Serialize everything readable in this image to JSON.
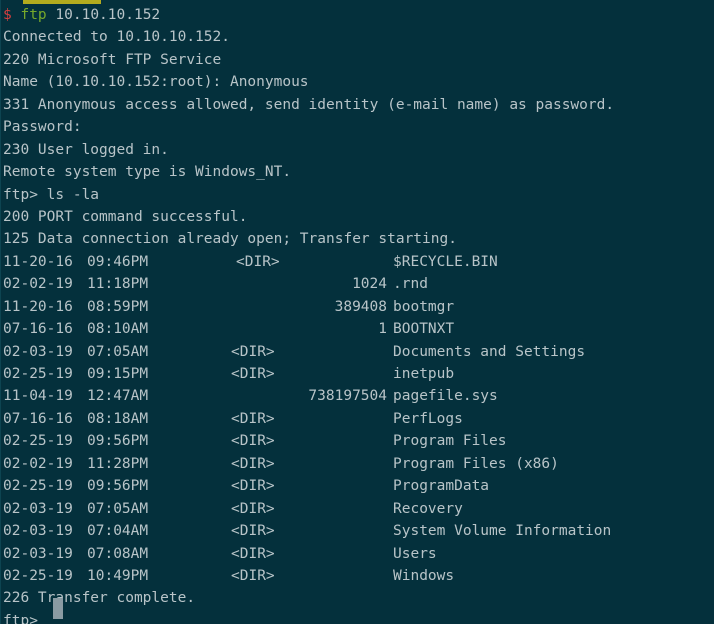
{
  "terminal": {
    "background_color": "#04303c",
    "foreground_color": "#b8c4c8",
    "prompt_sigil_color": "#d43f3f",
    "command_color": "#76a82b",
    "cursor_color": "#8a9ba3",
    "scrollback_sliver_color": "#b3ab1e"
  },
  "session": {
    "shell_prompt": {
      "sigil": "$",
      "command": "ftp",
      "argument": "10.10.10.152"
    },
    "connect_output": [
      "Connected to 10.10.10.152.",
      "220 Microsoft FTP Service",
      "Name (10.10.10.152:root): Anonymous",
      "331 Anonymous access allowed, send identity (e-mail name) as password.",
      "Password:",
      "230 User logged in.",
      "Remote system type is Windows_NT."
    ],
    "ftp_prompt": "ftp>",
    "ls_command": "ls -la",
    "transfer_begin": [
      "200 PORT command successful.",
      "125 Data connection already open; Transfer starting."
    ],
    "transfer_end": "226 Transfer complete.",
    "final_prompt": "ftp>"
  },
  "listing": {
    "columns": [
      "date",
      "time",
      "size_or_dir",
      "name"
    ],
    "dir_marker": "<DIR>",
    "rows": [
      {
        "date": "11-20-16",
        "time": "09:46PM",
        "dir": "<DIR>",
        "size": "",
        "name": "$RECYCLE.BIN"
      },
      {
        "date": "02-02-19",
        "time": "11:18PM",
        "dir": "",
        "size": "1024",
        "name": ".rnd"
      },
      {
        "date": "11-20-16",
        "time": "08:59PM",
        "dir": "",
        "size": "389408",
        "name": "bootmgr"
      },
      {
        "date": "07-16-16",
        "time": "08:10AM",
        "dir": "",
        "size": "1",
        "name": "BOOTNXT"
      },
      {
        "date": "02-03-19",
        "time": "07:05AM",
        "dir": "<DIR>",
        "size": "",
        "name": "Documents and Settings"
      },
      {
        "date": "02-25-19",
        "time": "09:15PM",
        "dir": "<DIR>",
        "size": "",
        "name": "inetpub"
      },
      {
        "date": "11-04-19",
        "time": "12:47AM",
        "dir": "",
        "size": "738197504",
        "name": "pagefile.sys"
      },
      {
        "date": "07-16-16",
        "time": "08:18AM",
        "dir": "<DIR>",
        "size": "",
        "name": "PerfLogs"
      },
      {
        "date": "02-25-19",
        "time": "09:56PM",
        "dir": "<DIR>",
        "size": "",
        "name": "Program Files"
      },
      {
        "date": "02-02-19",
        "time": "11:28PM",
        "dir": "<DIR>",
        "size": "",
        "name": "Program Files (x86)"
      },
      {
        "date": "02-25-19",
        "time": "09:56PM",
        "dir": "<DIR>",
        "size": "",
        "name": "ProgramData"
      },
      {
        "date": "02-03-19",
        "time": "07:05AM",
        "dir": "<DIR>",
        "size": "",
        "name": "Recovery"
      },
      {
        "date": "02-03-19",
        "time": "07:04AM",
        "dir": "<DIR>",
        "size": "",
        "name": "System Volume Information"
      },
      {
        "date": "02-03-19",
        "time": "07:08AM",
        "dir": "<DIR>",
        "size": "",
        "name": "Users"
      },
      {
        "date": "02-25-19",
        "time": "10:49PM",
        "dir": "<DIR>",
        "size": "",
        "name": "Windows"
      }
    ]
  }
}
